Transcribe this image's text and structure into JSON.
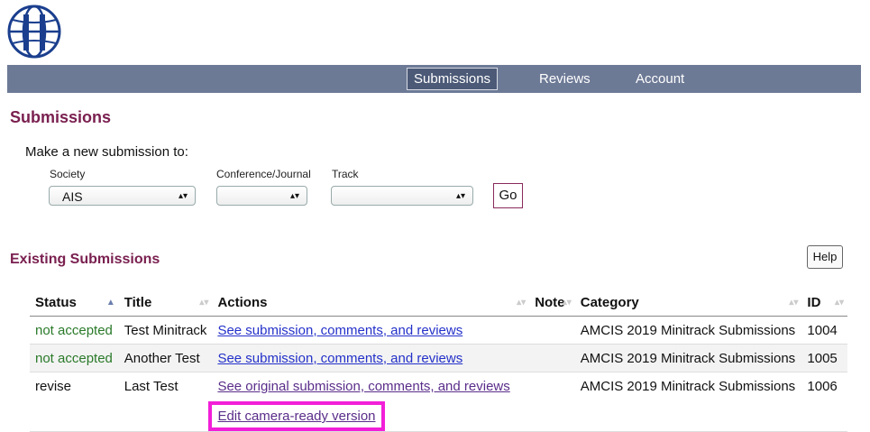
{
  "nav": {
    "items": [
      "Submissions",
      "Reviews",
      "Account"
    ],
    "active": "Submissions"
  },
  "page_title": "Submissions",
  "new_submission": {
    "prompt": "Make a new submission to:",
    "society_label": "Society",
    "society_value": "AIS",
    "conference_label": "Conference/Journal",
    "conference_value": "",
    "track_label": "Track",
    "track_value": "",
    "go_label": "Go"
  },
  "existing": {
    "title": "Existing Submissions",
    "help_label": "Help",
    "columns": [
      "Status",
      "Title",
      "Actions",
      "Note",
      "Category",
      "ID"
    ],
    "rows": [
      {
        "status": "not accepted",
        "title": "Test Minitrack",
        "action": "See submission, comments, and reviews",
        "note": "",
        "category": "AMCIS 2019 Minitrack Submissions",
        "id": "1004"
      },
      {
        "status": "not accepted",
        "title": "Another Test",
        "action": "See submission, comments, and reviews",
        "note": "",
        "category": "AMCIS 2019 Minitrack Submissions",
        "id": "1005"
      },
      {
        "status": "revise",
        "title": "Last Test",
        "action": "See original submission, comments, and reviews",
        "action2": "Edit camera-ready version",
        "note": "",
        "category": "AMCIS 2019 Minitrack Submissions",
        "id": "1006"
      }
    ]
  },
  "colors": {
    "accent": "#7a2050",
    "nav_bg": "#6d7a96",
    "highlight": "#f21fd8",
    "link": "#2431c9"
  }
}
